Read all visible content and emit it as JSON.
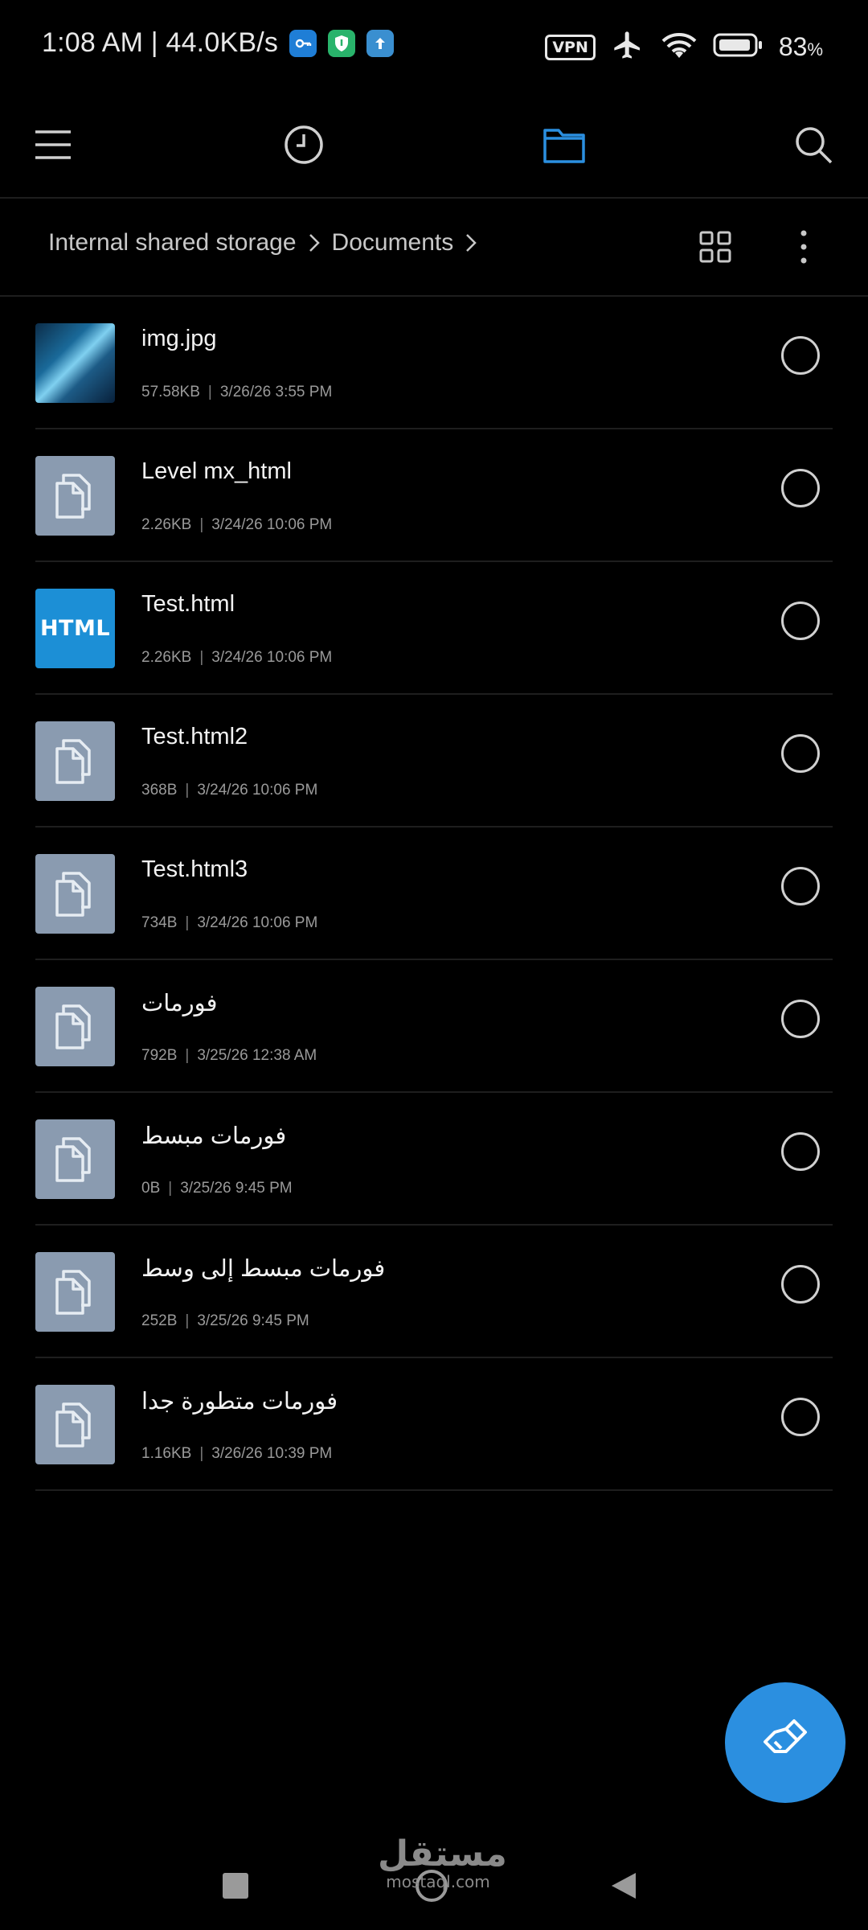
{
  "status_bar": {
    "time_speed": "1:08 AM | 44.0KB/s",
    "vpn_label": "VPN",
    "battery": "83",
    "battery_unit": "%",
    "app_icons": [
      "key-app-icon",
      "shield-app-icon",
      "upload-app-icon"
    ],
    "colors": {
      "key": "#1f7ed6",
      "shield": "#29b36b",
      "upload": "#3a8fd0"
    }
  },
  "toolbar": {
    "icons": [
      "menu-icon",
      "recent-clock-icon",
      "folder-icon",
      "search-icon"
    ],
    "active": "folder-icon",
    "active_color": "#2b8fe0"
  },
  "breadcrumb": {
    "items": [
      "Internal shared storage",
      "Documents"
    ]
  },
  "files": [
    {
      "name": "img.jpg",
      "size": "57.58KB",
      "date": "3/26/26 3:55 PM",
      "type": "image"
    },
    {
      "name": "Level mx_html",
      "size": "2.26KB",
      "date": "3/24/26 10:06 PM",
      "type": "doc"
    },
    {
      "name": "Test.html",
      "size": "2.26KB",
      "date": "3/24/26 10:06 PM",
      "type": "html"
    },
    {
      "name": "Test.html2",
      "size": "368B",
      "date": "3/24/26 10:06 PM",
      "type": "doc"
    },
    {
      "name": "Test.html3",
      "size": "734B",
      "date": "3/24/26 10:06 PM",
      "type": "doc"
    },
    {
      "name": "فورمات",
      "size": "792B",
      "date": "3/25/26 12:38 AM",
      "type": "doc"
    },
    {
      "name": "فورمات مبسط",
      "size": "0B",
      "date": "3/25/26 9:45 PM",
      "type": "doc"
    },
    {
      "name": "فورمات مبسط إلى وسط",
      "size": "252B",
      "date": "3/25/26 9:45 PM",
      "type": "doc"
    },
    {
      "name": "فورمات متطورة جدا",
      "size": "1.16KB",
      "date": "3/26/26 10:39 PM",
      "type": "doc"
    }
  ],
  "html_thumb_label": "HTML",
  "fab": {
    "icon": "broom-clean-icon",
    "color": "#2b8fe0"
  },
  "watermark": {
    "arabic": "مستقل",
    "latin": "mostaql.com"
  },
  "nav_bar": {
    "icons": [
      "recents-square-icon",
      "home-circle-icon",
      "back-triangle-icon"
    ]
  }
}
